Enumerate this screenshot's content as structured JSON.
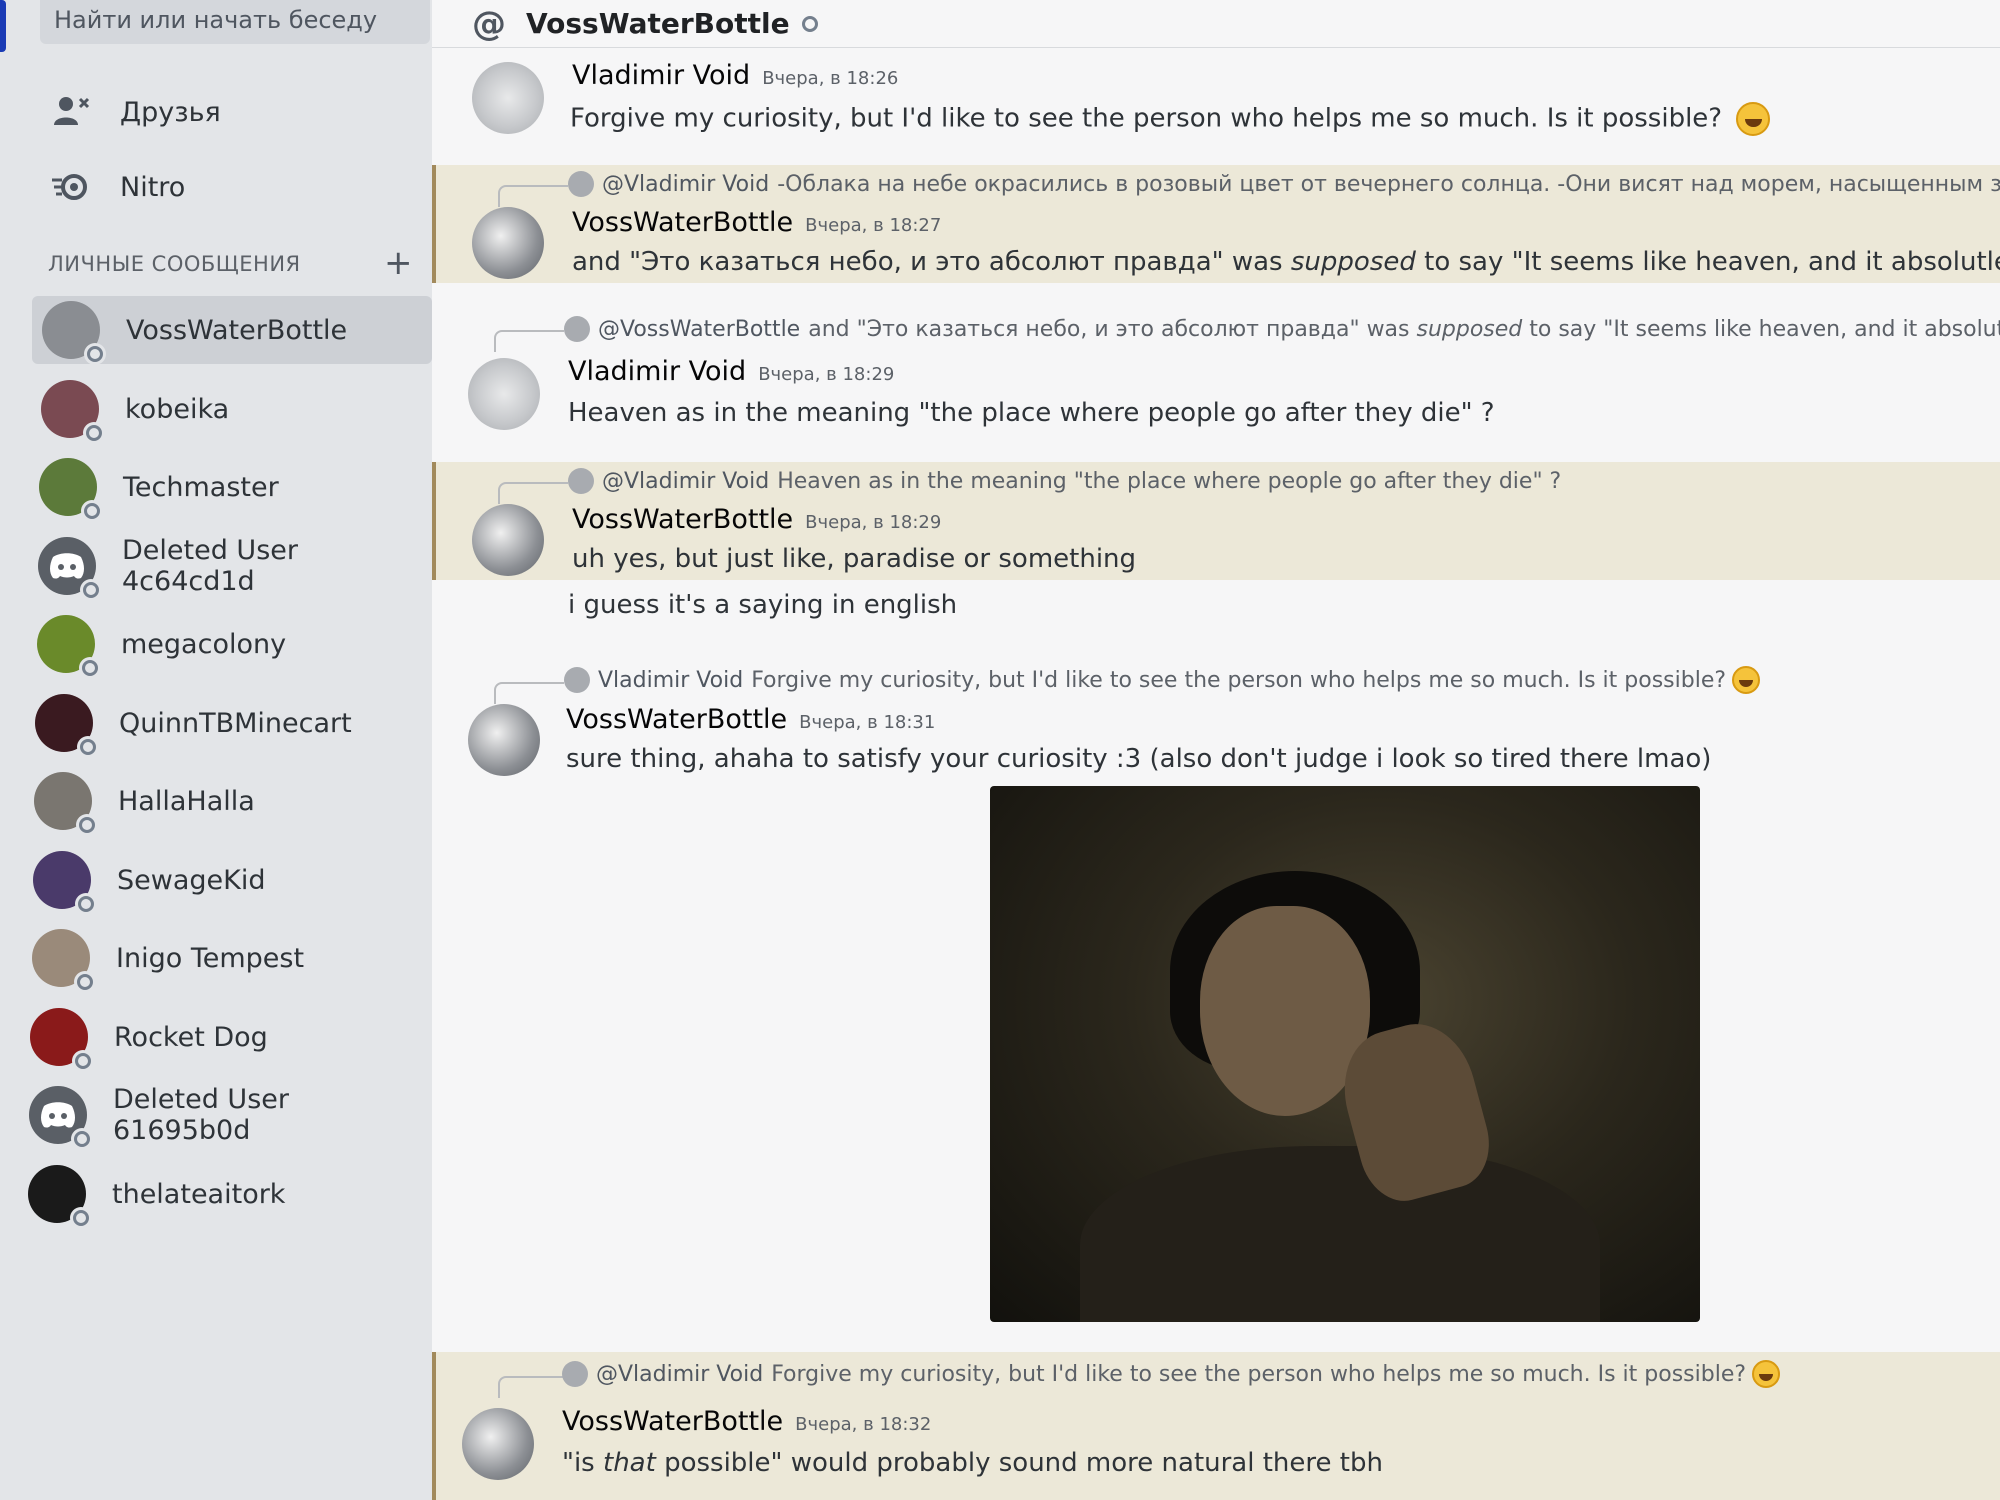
{
  "sidebar": {
    "search_placeholder": "Найти или начать беседу",
    "friends_label": "Друзья",
    "nitro_label": "Nitro",
    "dm_header": "ЛИЧНЫЕ СООБЩЕНИЯ",
    "dm_add": "+",
    "dms": [
      {
        "name": "VossWaterBottle",
        "selected": true,
        "color": "#8a8d92"
      },
      {
        "name": "kobeika",
        "color": "#7a4a52"
      },
      {
        "name": "Techmaster",
        "color": "#5c7a3a"
      },
      {
        "name": "Deleted User 4c64cd1d",
        "color": "#5a5f66"
      },
      {
        "name": "megacolony",
        "color": "#6a8a2a"
      },
      {
        "name": "QuinnTBMinecart",
        "color": "#3a1a20"
      },
      {
        "name": "HallaHalla",
        "color": "#7a7670"
      },
      {
        "name": "SewageKid",
        "color": "#4a3a6a"
      },
      {
        "name": "Inigo Tempest",
        "color": "#9a8a7a"
      },
      {
        "name": "Rocket Dog",
        "color": "#8a1a1a"
      },
      {
        "name": "Deleted User 61695b0d",
        "color": "#5a5f66"
      },
      {
        "name": "thelateaitork",
        "color": "#1a1a1a"
      }
    ]
  },
  "chat": {
    "title": "VossWaterBottle",
    "messages": [
      {
        "author": "Vladimir Void",
        "time": "Вчера, в 18:26",
        "text": "Forgive my curiosity, but I'd like to see the person who helps me so much. Is it possible?"
      },
      {
        "reply_to": "@Vladimir Void",
        "reply_text": "-Облака на небе окрасились в розовый цвет от вечернего солнца.  -Они висят над морем, насыщенным зелёным, син",
        "author": "VossWaterBottle",
        "time": "Вчера, в 18:27",
        "text_pre": "and \"Это казаться небо, и это абсолют правда\" was ",
        "text_em": "supposed",
        "text_post": " to say \"It seems like heaven, and it absolutley is/ is absolutley"
      },
      {
        "reply_to": "@VossWaterBottle",
        "reply_pre": "and \"Это казаться небо, и это абсолют правда\" was ",
        "reply_em": "supposed",
        "reply_post": " to say \"It seems like heaven, and it absolutley is/ is abso",
        "author": "Vladimir Void",
        "time": "Вчера, в 18:29",
        "text": "Heaven as in the meaning \"the place where people go after they die\" ?"
      },
      {
        "reply_to": "@Vladimir Void",
        "reply_text": "Heaven as in the meaning \"the place where people go after they die\" ?",
        "author": "VossWaterBottle",
        "time": "Вчера, в 18:29",
        "text": "uh yes, but just like, paradise or something",
        "text2": "i guess it's a saying in english"
      },
      {
        "reply_to": "Vladimir Void",
        "reply_text": "Forgive my curiosity, but I'd like to see the person who helps me so much. Is it possible?",
        "author": "VossWaterBottle",
        "time": "Вчера, в 18:31",
        "text": "sure thing, ahaha to satisfy your curiosity :3 (also don't judge i look so tired there lmao)"
      },
      {
        "reply_to": "@Vladimir Void",
        "reply_text": "Forgive my curiosity, but I'd like to see the person who helps me so much. Is it possible?",
        "author": "VossWaterBottle",
        "time": "Вчера, в 18:32",
        "text_pre": "\"is ",
        "text_em": "that",
        "text_post": " possible\" would probably sound more natural there tbh"
      }
    ]
  }
}
